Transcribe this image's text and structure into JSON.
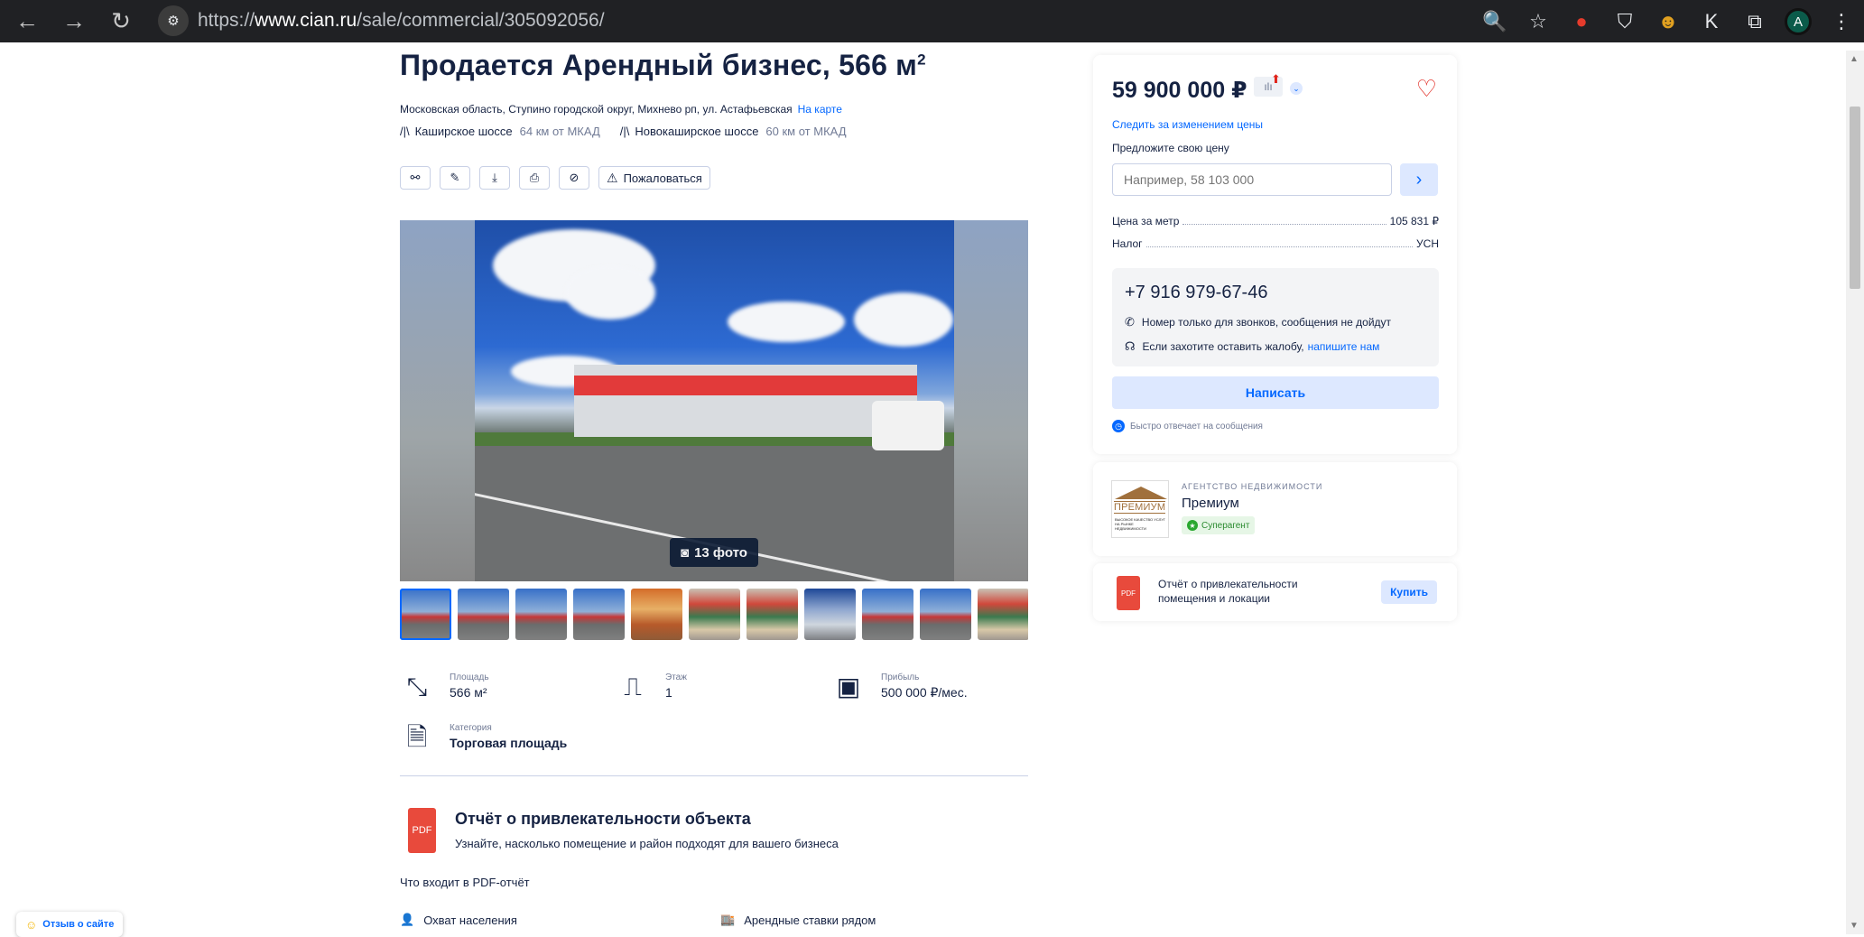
{
  "browser": {
    "url_prefix": "https://",
    "url_host": "www.cian.ru",
    "url_path": "/sale/commercial/305092056/",
    "profile_initial": "A",
    "ext_k_label": "K"
  },
  "listing": {
    "title_main": "Продается Арендный бизнес, 566 м",
    "title_sup": "2",
    "address": "Московская область, Ступино городской округ, Михнево рп, ул. Астафьевская",
    "map_link": "На карте",
    "highways": [
      {
        "name": "Каширское шоссе",
        "distance": "64 км от МКАД"
      },
      {
        "name": "Новокаширское шоссе",
        "distance": "60 км от МКАД"
      }
    ],
    "complain_label": "Пожаловаться",
    "photo_count": "13 фото"
  },
  "features": {
    "area": {
      "label": "Площадь",
      "value": "566 м²"
    },
    "floor": {
      "label": "Этаж",
      "value": "1"
    },
    "profit": {
      "label": "Прибыль",
      "value": "500 000 ₽/мес."
    },
    "category": {
      "label": "Категория",
      "value": "Торговая площадь"
    }
  },
  "report_section": {
    "pdf_label": "PDF",
    "title": "Отчёт о привлекательности объекта",
    "subtitle": "Узнайте, насколько помещение и район подходят для вашего бизнеса",
    "includes_label": "Что входит в PDF-отчёт",
    "items": [
      "Охват населения",
      "Арендные ставки рядом"
    ]
  },
  "feedback": {
    "label": "Отзыв о сайте"
  },
  "price_card": {
    "price": "59 900 000 ₽",
    "follow_link": "Следить за изменением цены",
    "offer_label": "Предложите свою цену",
    "offer_placeholder": "Например, 58 103 000",
    "price_per_meter_label": "Цена за метр",
    "price_per_meter_value": "105 831 ₽",
    "tax_label": "Налог",
    "tax_value": "УСН",
    "phone": "+7 916 979-67-46",
    "calls_only": "Номер только для звонков, сообщения не дойдут",
    "complaint_prefix": "Если захотите оставить жалобу,",
    "complaint_link": "напишите нам",
    "write_button": "Написать",
    "fast_reply": "Быстро отвечает на сообщения"
  },
  "agency": {
    "kicker": "АГЕНТСТВО НЕДВИЖИМОСТИ",
    "name": "Премиум",
    "badge": "Суперагент",
    "logo_word": "ПРЕМИУМ",
    "logo_small": "ВЫСОКОЕ КАЧЕСТВО УСЛУГ НА РЫНКЕ НЕДВИЖИМОСТИ"
  },
  "report_card": {
    "pdf_label": "PDF",
    "text": "Отчёт о привлекательности помещения и локации",
    "buy_button": "Купить"
  },
  "colors": {
    "brand_blue": "#0468ff",
    "text_dark": "#152242",
    "favorite_red": "#e0241b",
    "pdf_red": "#e84a3c"
  }
}
